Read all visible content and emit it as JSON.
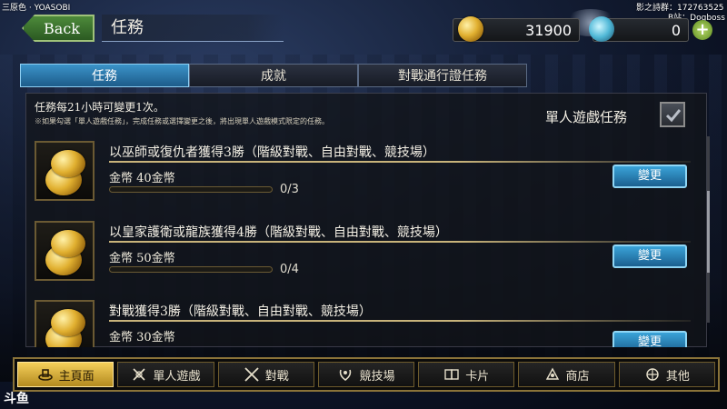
{
  "overlay": {
    "song": "三原色 · YOASOBI",
    "group": "影之詩群：172763525",
    "bilibili": "B站：Dogboss",
    "watermark": "斗鱼"
  },
  "header": {
    "back_label": "Back",
    "title": "任務",
    "gold_amount": "31900",
    "crystal_amount": "0",
    "plus_label": "+"
  },
  "tabs": [
    {
      "label": "任務",
      "active": true
    },
    {
      "label": "成就",
      "active": false
    },
    {
      "label": "對戰通行證任務",
      "active": false
    }
  ],
  "notice": {
    "main": "任務每21小時可變更1次。",
    "sub": "※如果勾選「單人遊戲任務」，完成任務或選擇變更之後，將出現單人遊戲模式限定的任務。",
    "solo_label": "單人遊戲任務"
  },
  "missions": [
    {
      "title": "以巫師或復仇者獲得3勝（階級對戰、自由對戰、競技場）",
      "reward": "金幣 40金幣",
      "progress": "0/3",
      "button": "變更"
    },
    {
      "title": "以皇家護衛或龍族獲得4勝（階級對戰、自由對戰、競技場）",
      "reward": "金幣 50金幣",
      "progress": "0/4",
      "button": "變更"
    },
    {
      "title": "對戰獲得3勝（階級對戰、自由對戰、競技場）",
      "reward": "金幣 30金幣",
      "progress": "",
      "button": "變更"
    }
  ],
  "nav": [
    {
      "label": "主頁面",
      "icon": "home-icon",
      "active": true
    },
    {
      "label": "單人遊戲",
      "icon": "solo-sword-icon",
      "active": false
    },
    {
      "label": "對戰",
      "icon": "crossed-swords-icon",
      "active": false
    },
    {
      "label": "競技場",
      "icon": "laurel-icon",
      "active": false
    },
    {
      "label": "卡片",
      "icon": "cards-icon",
      "active": false
    },
    {
      "label": "商店",
      "icon": "shop-icon",
      "active": false
    },
    {
      "label": "其他",
      "icon": "other-icon",
      "active": false
    }
  ]
}
